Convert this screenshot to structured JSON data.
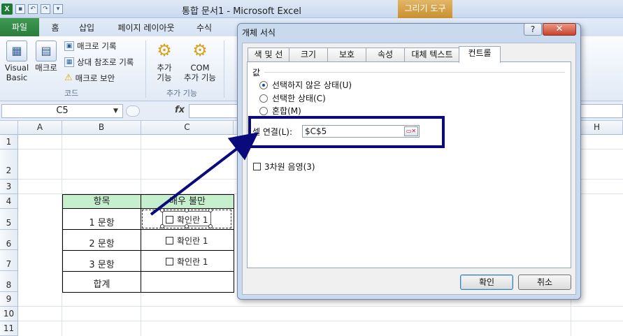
{
  "window": {
    "title": "통합 문서1 - Microsoft Excel",
    "context_tab": "그리기 도구",
    "app_icon": "X"
  },
  "ribbon": {
    "tabs": [
      "파일",
      "홈",
      "삽입",
      "페이지 레이아웃",
      "수식"
    ],
    "code_group": {
      "label": "코드",
      "visual_basic_l1": "Visual",
      "visual_basic_l2": "Basic",
      "macro": "매크로",
      "record_macro": "매크로 기록",
      "relative_ref": "상대 참조로 기록",
      "macro_security": "매크로 보안"
    },
    "addins_group": {
      "label": "추가 기능",
      "addins_l1": "추가",
      "addins_l2": "기능",
      "com_l1": "COM",
      "com_l2": "추가 기능"
    }
  },
  "formula_bar": {
    "name_box": "C5",
    "fx": "fx",
    "formula": ""
  },
  "grid": {
    "columns": [
      "A",
      "B",
      "C",
      "H"
    ],
    "rows": [
      "1",
      "2",
      "3",
      "4",
      "5",
      "6",
      "7",
      "8",
      "9",
      "10",
      "11"
    ],
    "header_item": "항목",
    "header_c": "매우 불만",
    "items": [
      "1 문항",
      "2 문항",
      "3 문항"
    ],
    "total": "합계",
    "checkbox_label": "확인란 1"
  },
  "dialog": {
    "title": "개체 서식",
    "help": "?",
    "close": "✕",
    "tabs": [
      "색 및 선",
      "크기",
      "보호",
      "속성",
      "대체 텍스트",
      "컨트롤"
    ],
    "active_tab": "컨트롤",
    "value_label": "값",
    "options": [
      "선택하지 않은 상태(U)",
      "선택한 상태(C)",
      "혼합(M)"
    ],
    "selected_option": "선택하지 않은 상태(U)",
    "cell_link_label": "셀 연결(L):",
    "cell_link_value": "$C$5",
    "shading_label": "3차원 음영(3)",
    "ok": "확인",
    "cancel": "취소"
  }
}
